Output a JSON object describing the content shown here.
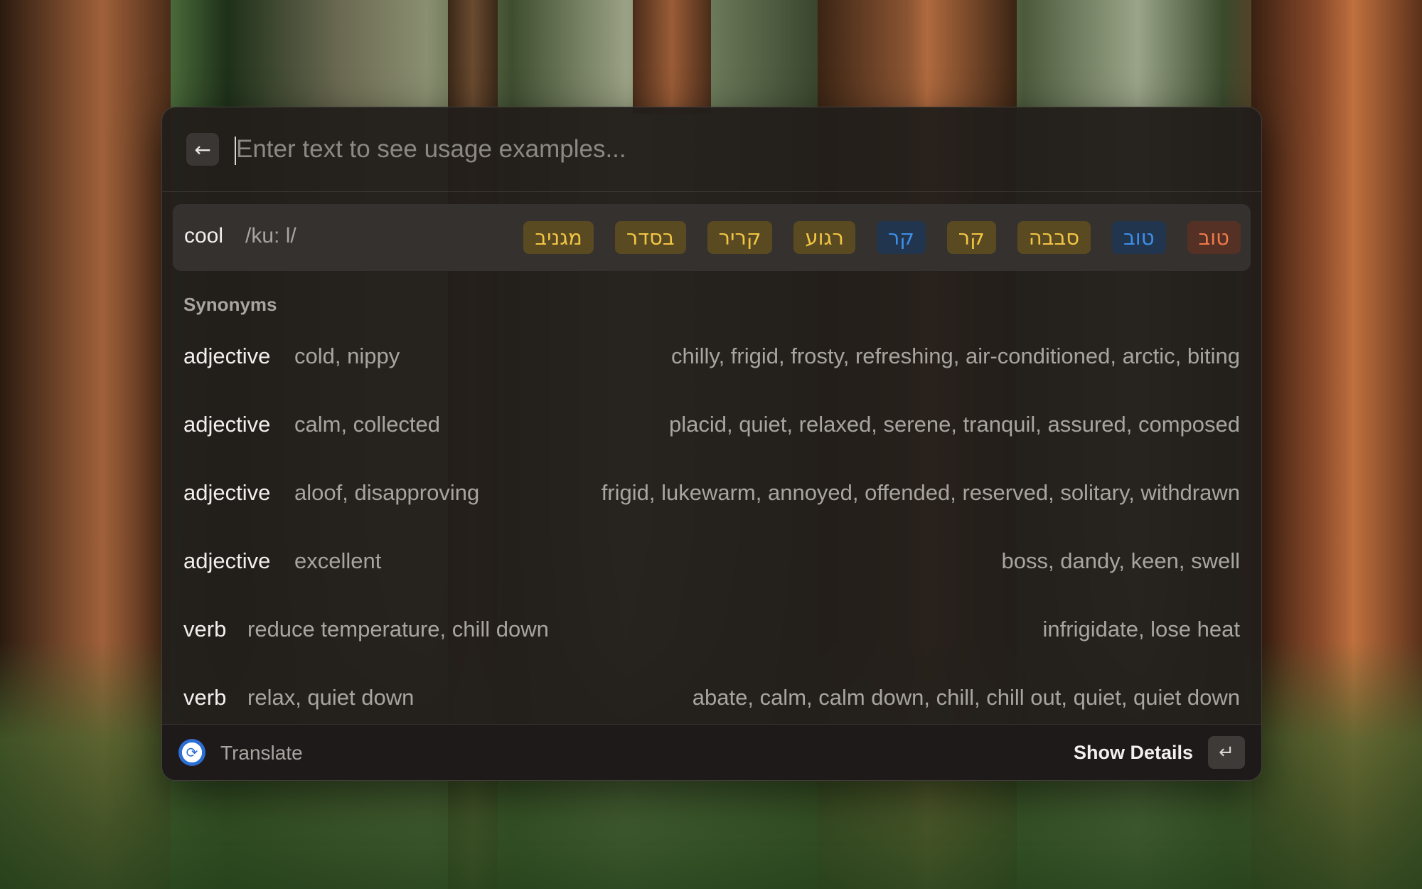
{
  "search": {
    "placeholder": "Enter text to see usage examples...",
    "back_icon": "←"
  },
  "entry": {
    "word": "cool",
    "phonetic": "/ku: l/",
    "translations": [
      {
        "text": "מגניב",
        "color": "#f2c544"
      },
      {
        "text": "בסדר",
        "color": "#f2c544"
      },
      {
        "text": "קריר",
        "color": "#f2c544"
      },
      {
        "text": "רגוע",
        "color": "#f2c544"
      },
      {
        "text": "קר",
        "color": "#3e8ee8"
      },
      {
        "text": "קר",
        "color": "#f2c544"
      },
      {
        "text": "סבבה",
        "color": "#f2c544"
      },
      {
        "text": "טוב",
        "color": "#3e8ee8"
      },
      {
        "text": "טוב",
        "color": "#f07a4a"
      }
    ]
  },
  "synonyms": {
    "title": "Synonyms",
    "rows": [
      {
        "pos": "adjective",
        "sense": "cold, nippy",
        "synonyms": "chilly, frigid, frosty, refreshing, air-conditioned, arctic, biting"
      },
      {
        "pos": "adjective",
        "sense": "calm, collected",
        "synonyms": "placid, quiet, relaxed, serene, tranquil, assured, composed"
      },
      {
        "pos": "adjective",
        "sense": "aloof, disapproving",
        "synonyms": "frigid, lukewarm, annoyed, offended, reserved, solitary, withdrawn"
      },
      {
        "pos": "adjective",
        "sense": "excellent",
        "synonyms": "boss, dandy, keen, swell"
      },
      {
        "pos": "verb",
        "sense": "reduce temperature, chill down",
        "synonyms": "infrigidate, lose heat"
      },
      {
        "pos": "verb",
        "sense": "relax, quiet down",
        "synonyms": "abate, calm, calm down, chill, chill out, quiet, quiet down"
      }
    ]
  },
  "footer": {
    "app_name": "Translate",
    "action_label": "Show Details",
    "enter_icon": "↵"
  }
}
